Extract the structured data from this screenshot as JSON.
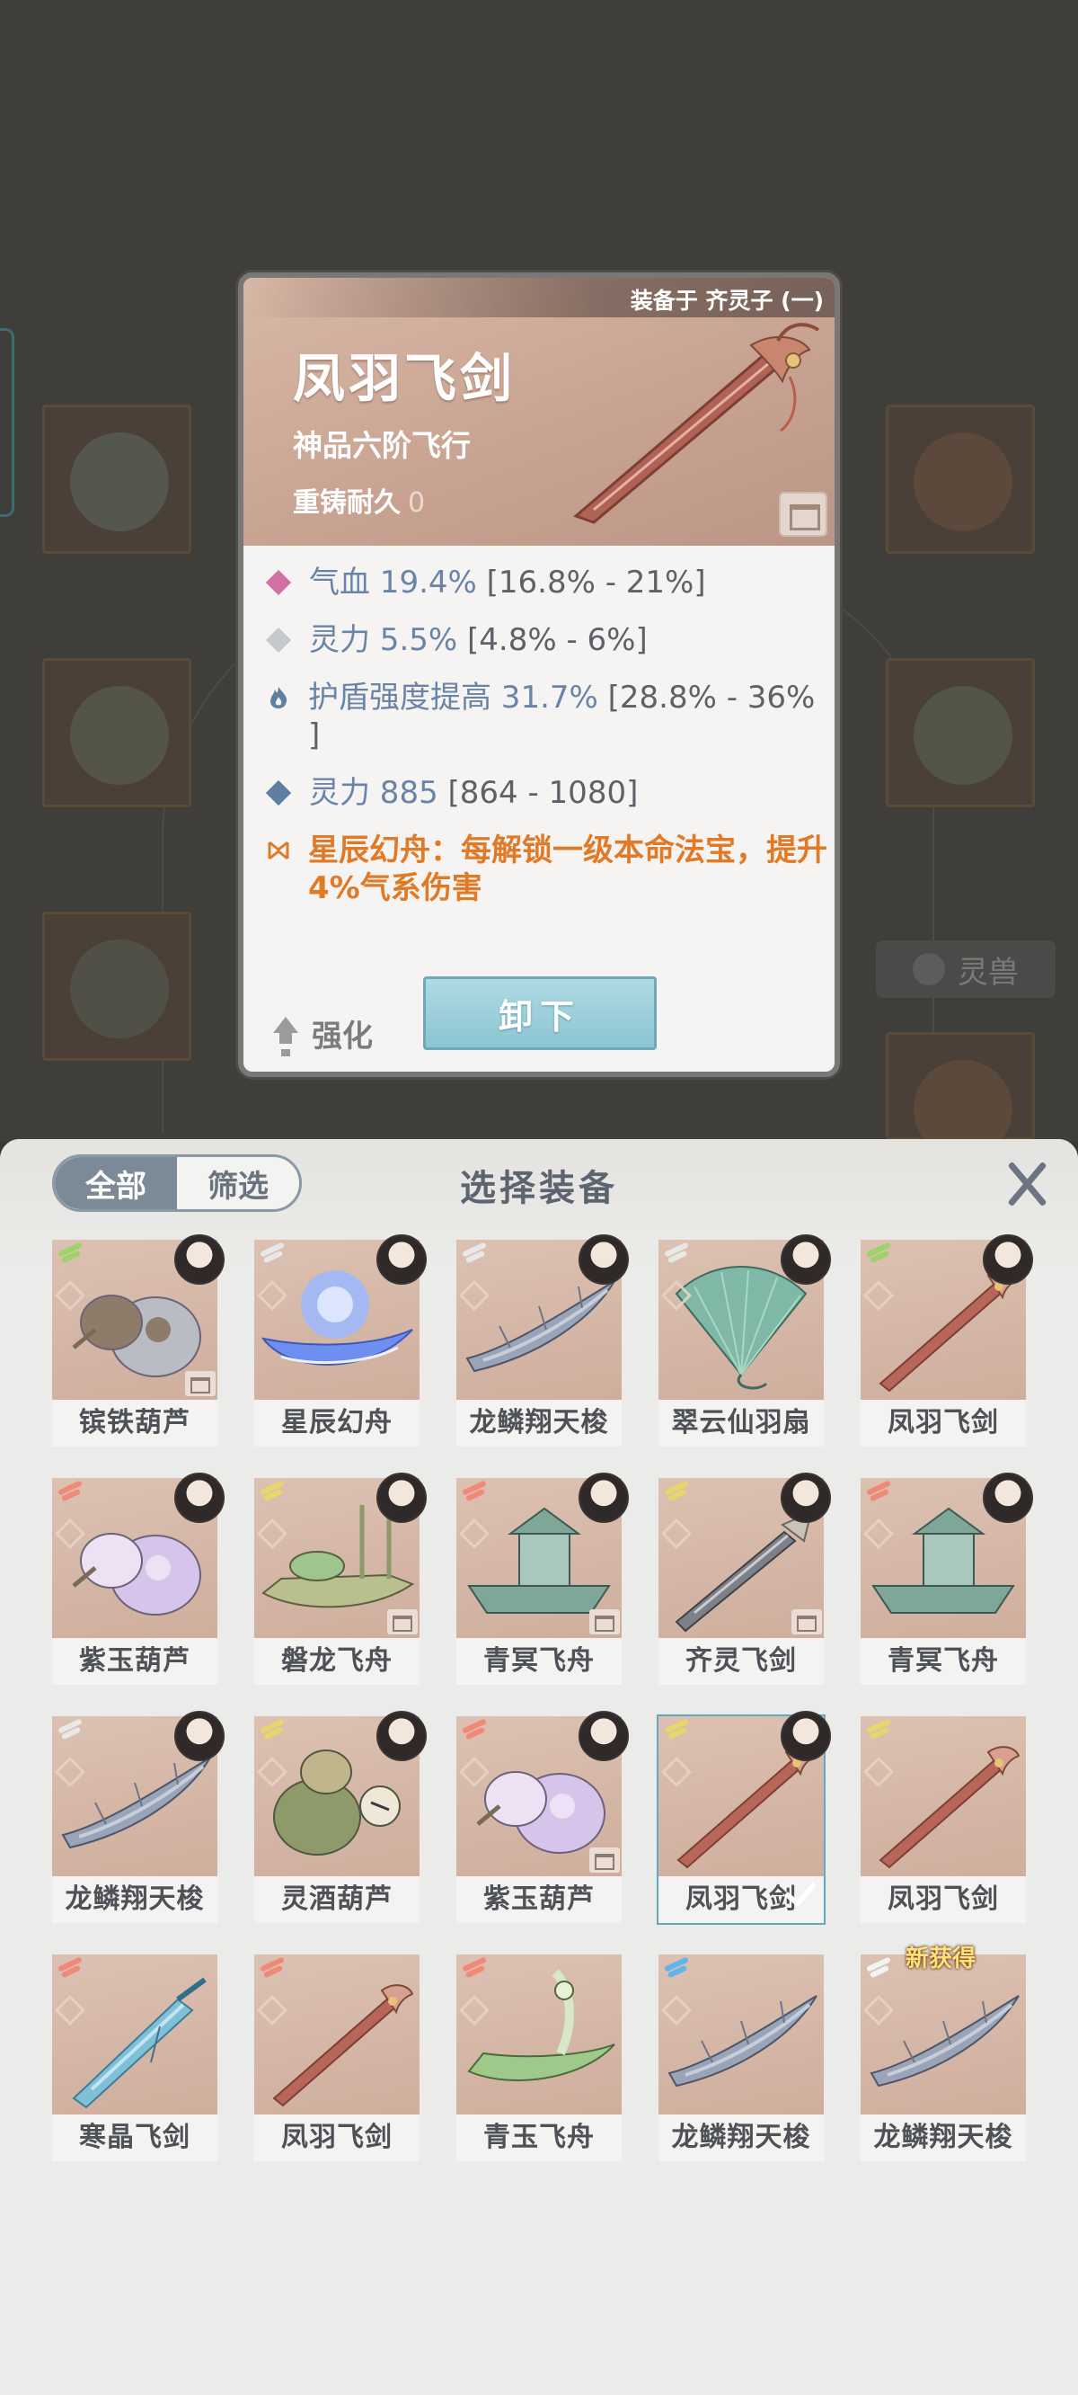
{
  "detail": {
    "equipped_on": "装备于 齐灵子 (一)",
    "title": "凤羽飞剑",
    "grade": "神品六阶飞行",
    "recast_label": "重铸耐久",
    "recast_value": "0",
    "stats": [
      {
        "icon": "pink-diamond-icon",
        "label": "气血 19.4%",
        "range": " [16.8% - 21%]",
        "color": "#d070a4"
      },
      {
        "icon": "grey-diamond-icon",
        "label": "灵力 5.5%",
        "range": " [4.8% - 6%]",
        "color": "#c6c9cc"
      },
      {
        "icon": "flame-icon",
        "label": "护盾强度提高 31.7%",
        "range": " [28.8% - 36% ]",
        "color": "#5f7fa3"
      },
      {
        "icon": "blue-diamond-icon",
        "label": "灵力 885",
        "range": " [864 - 1080]",
        "color": "#5e7ea3"
      }
    ],
    "special": "星辰幻舟：每解锁一级本命法宝，提升4%气系伤害",
    "enhance_label": "强化",
    "unequip_label": "卸下"
  },
  "background": {
    "pet_button": "灵兽"
  },
  "panel": {
    "tab_all": "全部",
    "tab_filter": "筛选",
    "title": "选择装备"
  },
  "items": [
    {
      "name": "镔铁葫芦",
      "wing": "#9cd36a",
      "char": true,
      "lock": true,
      "art": "gourd",
      "c1": "#b9bcc3",
      "c2": "#8e7c6a"
    },
    {
      "name": "星辰幻舟",
      "wing": "#e8e8e8",
      "char": true,
      "lock": false,
      "art": "boat-blue",
      "c1": "#6e8ff0",
      "c2": "#9bb8ff"
    },
    {
      "name": "龙鳞翔天梭",
      "wing": "#e8e8e8",
      "char": true,
      "lock": false,
      "art": "shuttle",
      "c1": "#9aa4b8",
      "c2": "#c7ced9"
    },
    {
      "name": "翠云仙羽扇",
      "wing": "#e8e8e8",
      "char": true,
      "lock": false,
      "art": "fan",
      "c1": "#7fb8a6",
      "c2": "#a8d7c4"
    },
    {
      "name": "凤羽飞剑",
      "wing": "#9cd36a",
      "char": true,
      "lock": false,
      "art": "sword",
      "c1": "#b8655a",
      "c2": "#d8a090"
    },
    {
      "name": "紫玉葫芦",
      "wing": "#f08a78",
      "char": true,
      "lock": false,
      "art": "gourd",
      "c1": "#d6c4ea",
      "c2": "#ece2f4"
    },
    {
      "name": "磐龙飞舟",
      "wing": "#e7d76a",
      "char": true,
      "lock": true,
      "art": "dragon-boat",
      "c1": "#b9c08e",
      "c2": "#8c9a6a"
    },
    {
      "name": "青冥飞舟",
      "wing": "#f08a78",
      "char": true,
      "lock": true,
      "art": "ship",
      "c1": "#7ea79a",
      "c2": "#a9c8bd"
    },
    {
      "name": "齐灵飞剑",
      "wing": "#e7d76a",
      "char": true,
      "lock": true,
      "art": "sword-grey",
      "c1": "#7d8088",
      "c2": "#c9ccd1"
    },
    {
      "name": "青冥飞舟",
      "wing": "#f08a78",
      "char": true,
      "lock": false,
      "art": "ship",
      "c1": "#7ea79a",
      "c2": "#a9c8bd"
    },
    {
      "name": "龙鳞翔天梭",
      "wing": "#e8e8e8",
      "char": true,
      "lock": false,
      "art": "shuttle",
      "c1": "#9aa4b8",
      "c2": "#c7ced9"
    },
    {
      "name": "灵酒葫芦",
      "wing": "#e7d76a",
      "char": true,
      "lock": false,
      "art": "gourd-green",
      "c1": "#8f9a6a",
      "c2": "#c1b58c"
    },
    {
      "name": "紫玉葫芦",
      "wing": "#f08a78",
      "char": true,
      "lock": true,
      "art": "gourd",
      "c1": "#d6c4ea",
      "c2": "#ece2f4"
    },
    {
      "name": "凤羽飞剑",
      "wing": "#e7d76a",
      "char": true,
      "lock": false,
      "art": "sword",
      "c1": "#b8655a",
      "c2": "#d8a090",
      "selected": true
    },
    {
      "name": "凤羽飞剑",
      "wing": "#e7d76a",
      "char": false,
      "lock": false,
      "art": "sword",
      "c1": "#b8655a",
      "c2": "#d8a090"
    },
    {
      "name": "寒晶飞剑",
      "wing": "#f08a78",
      "char": false,
      "lock": false,
      "art": "sword-ice",
      "c1": "#7fc0d8",
      "c2": "#c2e6f1"
    },
    {
      "name": "凤羽飞剑",
      "wing": "#f08a78",
      "char": false,
      "lock": false,
      "art": "sword",
      "c1": "#b8655a",
      "c2": "#d8a090"
    },
    {
      "name": "青玉飞舟",
      "wing": "#f08a78",
      "char": false,
      "lock": false,
      "art": "jade-boat",
      "c1": "#9ec98a",
      "c2": "#d8e8c6"
    },
    {
      "name": "龙鳞翔天梭",
      "wing": "#5fb5ea",
      "char": false,
      "lock": false,
      "art": "shuttle",
      "c1": "#9aa4b8",
      "c2": "#c7ced9"
    },
    {
      "name": "龙鳞翔天梭",
      "wing": "#f3f3f3",
      "char": false,
      "lock": false,
      "art": "shuttle",
      "c1": "#9aa4b8",
      "c2": "#c7ced9",
      "badge": "新获得"
    }
  ]
}
